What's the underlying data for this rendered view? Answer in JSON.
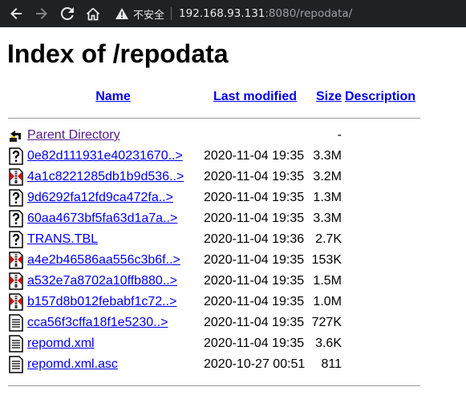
{
  "browser": {
    "security_label": "不安全",
    "url_host": "192.168.93.131",
    "url_path": ":8080/repodata/"
  },
  "page": {
    "title": "Index of /repodata",
    "columns": {
      "name": "Name",
      "modified": "Last modified",
      "size": "Size",
      "description": "Description"
    }
  },
  "parent": {
    "label": "Parent Directory",
    "size": "-"
  },
  "files": [
    {
      "name": "0e82d111931e40231670..>",
      "modified": "2020-11-04 19:35",
      "size": "3.3M",
      "icon": "unknown-file-icon"
    },
    {
      "name": "4a1c8221285db1b9d536..>",
      "modified": "2020-11-04 19:35",
      "size": "3.2M",
      "icon": "compressed-file-icon"
    },
    {
      "name": "9d6292fa12fd9ca472fa..>",
      "modified": "2020-11-04 19:35",
      "size": "1.3M",
      "icon": "unknown-file-icon"
    },
    {
      "name": "60aa4673bf5fa63d1a7a..>",
      "modified": "2020-11-04 19:35",
      "size": "3.3M",
      "icon": "unknown-file-icon"
    },
    {
      "name": "TRANS.TBL",
      "modified": "2020-11-04 19:36",
      "size": "2.7K",
      "icon": "unknown-file-icon"
    },
    {
      "name": "a4e2b46586aa556c3b6f..>",
      "modified": "2020-11-04 19:35",
      "size": "153K",
      "icon": "compressed-file-icon"
    },
    {
      "name": "a532e7a8702a10ffb880..>",
      "modified": "2020-11-04 19:35",
      "size": "1.5M",
      "icon": "compressed-file-icon"
    },
    {
      "name": "b157d8b012febabf1c72..>",
      "modified": "2020-11-04 19:35",
      "size": "1.0M",
      "icon": "compressed-file-icon"
    },
    {
      "name": "cca56f3cffa18f1e5230..>",
      "modified": "2020-11-04 19:35",
      "size": "727K",
      "icon": "text-file-icon"
    },
    {
      "name": "repomd.xml",
      "modified": "2020-11-04 19:35",
      "size": "3.6K",
      "icon": "text-file-icon"
    },
    {
      "name": "repomd.xml.asc",
      "modified": "2020-10-27 00:51",
      "size": "811",
      "icon": "text-file-icon"
    }
  ]
}
